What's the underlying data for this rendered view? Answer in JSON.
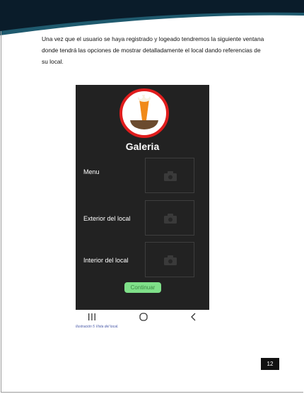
{
  "document": {
    "intro_text": "Una vez que el usuario se haya registrado y logeado tendremos la siguiente ventana donde tendrá las opciones de mostrar detalladamente el local dando referencias de su local.",
    "figure_caption": "Ilustración 5 Vista del local.",
    "page_number": "12"
  },
  "app": {
    "title": "Galeria",
    "rows": [
      {
        "label": "Menu",
        "icon": "camera-icon"
      },
      {
        "label": "Exterior del local",
        "icon": "camera-icon"
      },
      {
        "label": "Interior del local",
        "icon": "camera-icon"
      }
    ],
    "continue_label": "Continuar",
    "navbar_icons": [
      "recent-apps-icon",
      "home-icon",
      "back-icon"
    ]
  },
  "colors": {
    "header_dark": "#0a1c2a",
    "header_teal": "#1f5a6e",
    "phone_bg": "#222222",
    "logo_ring": "#e01d1d",
    "button_green": "#7fe089",
    "caption_blue": "#4a5aa8"
  }
}
